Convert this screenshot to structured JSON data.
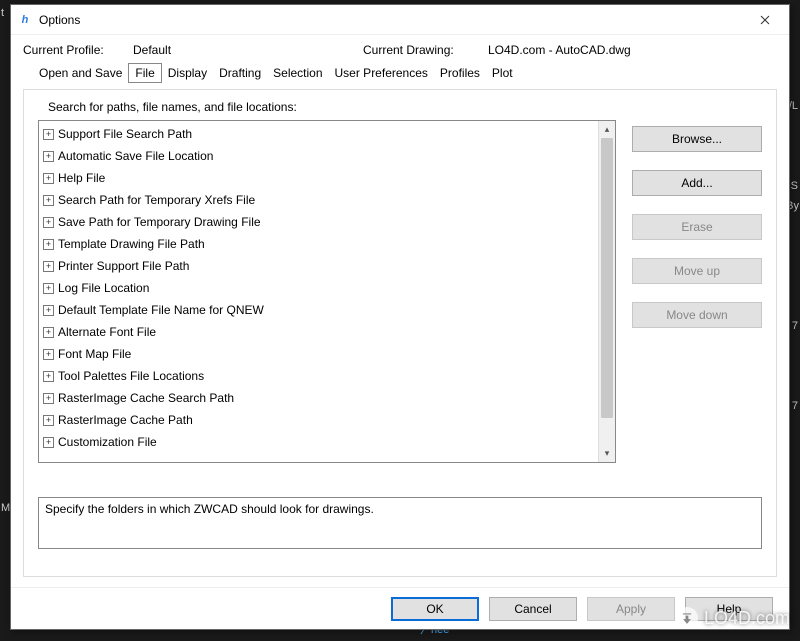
{
  "window": {
    "title": "Options",
    "profile_label": "Current Profile:",
    "profile_value": "Default",
    "drawing_label": "Current Drawing:",
    "drawing_value": "LO4D.com - AutoCAD.dwg"
  },
  "tabs": [
    "Open and Save",
    "File",
    "Display",
    "Drafting",
    "Selection",
    "User Preferences",
    "Profiles",
    "Plot"
  ],
  "active_tab": "File",
  "panel": {
    "heading": "Search for paths, file names, and file locations:",
    "items": [
      "Support File Search Path",
      "Automatic Save File Location",
      "Help File",
      "Search Path for Temporary Xrefs File",
      "Save Path for Temporary Drawing File",
      "Template Drawing File Path",
      "Printer Support File Path",
      "Log File Location",
      "Default Template File Name for QNEW",
      "Alternate Font File",
      "Font Map File",
      "Tool Palettes File Locations",
      "RasterImage Cache Search Path",
      "RasterImage Cache Path",
      "Customization File"
    ],
    "description": "Specify the folders in which ZWCAD should look for drawings."
  },
  "side_buttons": {
    "browse": "Browse...",
    "add": "Add...",
    "erase": "Erase",
    "move_up": "Move up",
    "move_down": "Move down"
  },
  "bottom_buttons": {
    "ok": "OK",
    "cancel": "Cancel",
    "apply": "Apply",
    "help": "Help"
  },
  "watermark": "LO4D.com",
  "bg": {
    "t1": "t",
    "t2": "M",
    "b1": "hee"
  }
}
